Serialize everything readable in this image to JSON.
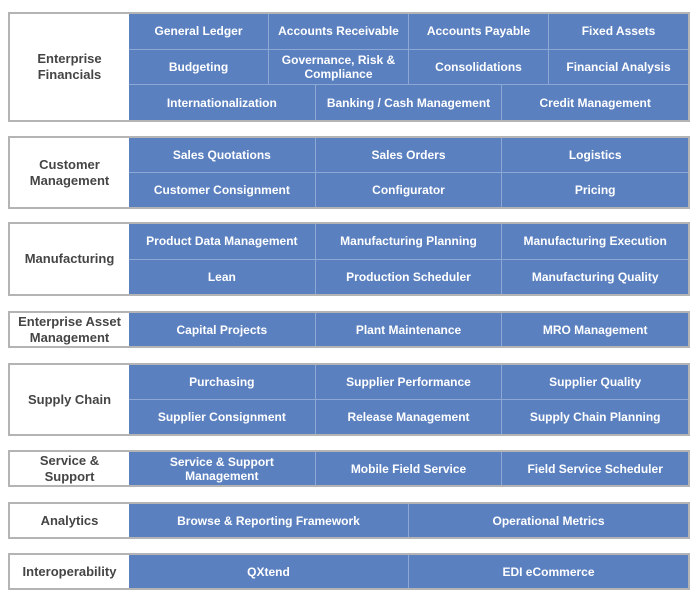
{
  "colors": {
    "cell": "#5b80c0",
    "divider": "#8ea8d6",
    "border": "#b4b4b4",
    "label_text": "#454545"
  },
  "sections": [
    {
      "label": "Enterprise Financials",
      "rows": [
        [
          "General Ledger",
          "Accounts Receivable",
          "Accounts Payable",
          "Fixed Assets"
        ],
        [
          "Budgeting",
          "Governance, Risk & Compliance",
          "Consolidations",
          "Financial Analysis"
        ],
        [
          "Internationalization",
          "Banking / Cash Management",
          "Credit Management"
        ]
      ]
    },
    {
      "label": "Customer Management",
      "rows": [
        [
          "Sales Quotations",
          "Sales Orders",
          "Logistics"
        ],
        [
          "Customer Consignment",
          "Configurator",
          "Pricing"
        ]
      ]
    },
    {
      "label": "Manufacturing",
      "rows": [
        [
          "Product Data Management",
          "Manufacturing Planning",
          "Manufacturing Execution"
        ],
        [
          "Lean",
          "Production Scheduler",
          "Manufacturing Quality"
        ]
      ]
    },
    {
      "label": "Enterprise Asset Management",
      "rows": [
        [
          "Capital Projects",
          "Plant Maintenance",
          "MRO Management"
        ]
      ]
    },
    {
      "label": "Supply Chain",
      "rows": [
        [
          "Purchasing",
          "Supplier Performance",
          "Supplier Quality"
        ],
        [
          "Supplier Consignment",
          "Release Management",
          "Supply Chain Planning"
        ]
      ]
    },
    {
      "label": "Service & Support",
      "rows": [
        [
          "Service & Support Management",
          "Mobile Field Service",
          "Field Service Scheduler"
        ]
      ]
    },
    {
      "label": "Analytics",
      "rows": [
        [
          "Browse & Reporting Framework",
          "Operational Metrics"
        ]
      ]
    },
    {
      "label": "Interoperability",
      "rows": [
        [
          "QXtend",
          "EDI eCommerce"
        ]
      ]
    }
  ]
}
